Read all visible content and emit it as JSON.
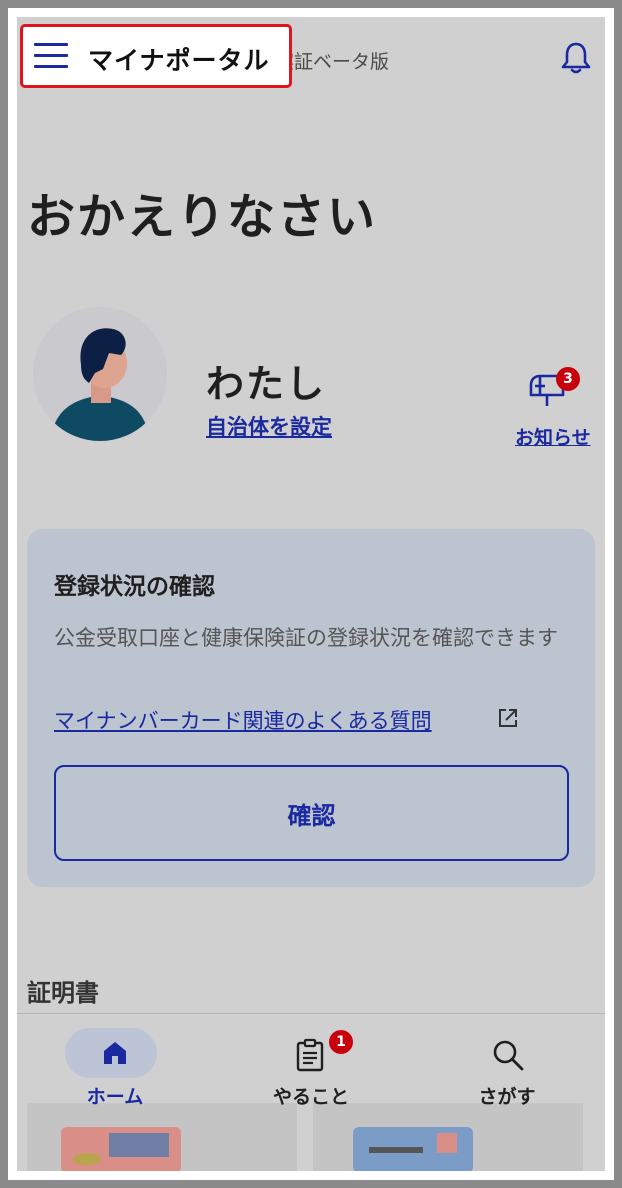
{
  "header": {
    "app_title": "マイナポータル",
    "subtitle": "実証ベータ版"
  },
  "greeting": "おかえりなさい",
  "user": {
    "name": "わたし",
    "set_municipality_link": "自治体を設定"
  },
  "notices": {
    "label": "お知らせ",
    "badge_count": "3"
  },
  "registration_card": {
    "title": "登録状況の確認",
    "description": "公金受取口座と健康保険証の登録状況を確認できます",
    "faq_link": "マイナンバーカード関連のよくある質問",
    "confirm_button": "確認"
  },
  "certificates_heading": "証明書",
  "bottom_nav": {
    "items": [
      {
        "label": "ホーム",
        "icon": "home-icon",
        "active": true
      },
      {
        "label": "やること",
        "icon": "clipboard-icon",
        "badge": "1"
      },
      {
        "label": "さがす",
        "icon": "search-icon"
      }
    ]
  },
  "colors": {
    "accent": "#1a29a0",
    "badge": "#c7000b",
    "highlight_border": "#e0141e"
  }
}
